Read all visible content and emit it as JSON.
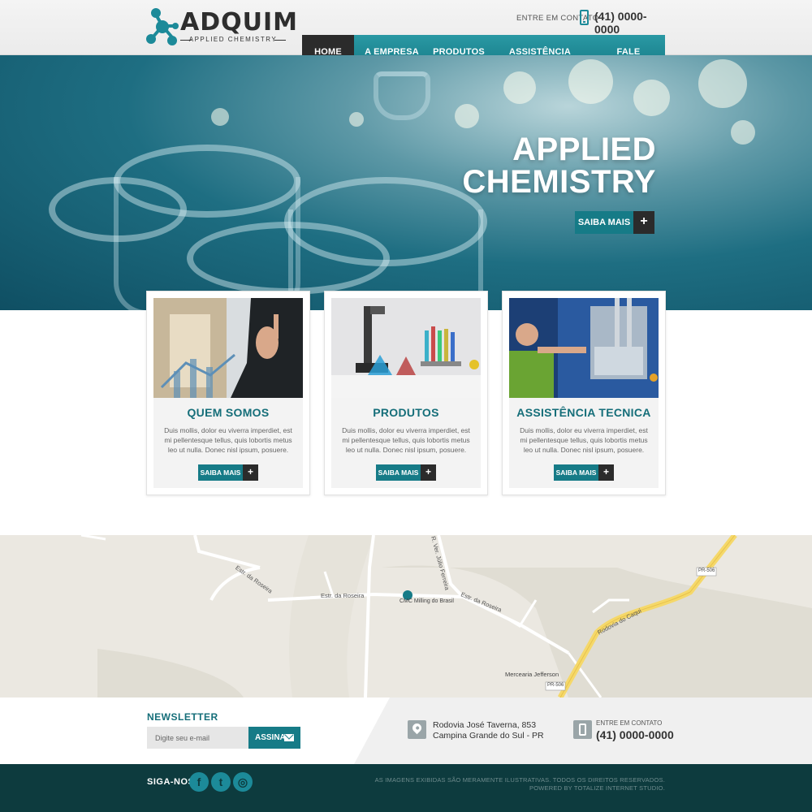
{
  "brand": {
    "name": "ADQUIM",
    "tagline": "APPLIED CHEMISTRY"
  },
  "header": {
    "contact_label": "ENTRE EM CONTATO",
    "phone": "(41) 0000-0000"
  },
  "nav": {
    "items": [
      "HOME",
      "A EMPRESA",
      "PRODUTOS",
      "ASSISTÊNCIA TÉCNICA",
      "FALE CONOSCO"
    ],
    "active": "HOME"
  },
  "hero": {
    "title_line1": "APPLIED",
    "title_line2": "CHEMISTRY",
    "button_label": "SAIBA MAIS",
    "button_icon": "+"
  },
  "cards": [
    {
      "title": "QUEM SOMOS",
      "text": "Duis mollis, dolor eu viverra imperdiet, est mi pellentesque tellus, quis lobortis metus leo ut nulla. Donec nisl ipsum, posuere.",
      "button_label": "SAIBA MAIS",
      "button_icon": "+"
    },
    {
      "title": "PRODUTOS",
      "text": "Duis mollis, dolor eu viverra imperdiet, est mi pellentesque tellus, quis lobortis metus leo ut nulla. Donec nisl ipsum, posuere.",
      "button_label": "SAIBA MAIS",
      "button_icon": "+"
    },
    {
      "title": "ASSISTÊNCIA TECNICA",
      "text": "Duis mollis, dolor eu viverra imperdiet, est mi pellentesque tellus, quis lobortis metus leo ut nulla. Donec nisl ipsum, posuere.",
      "button_label": "SAIBA MAIS",
      "button_icon": "+"
    }
  ],
  "map": {
    "labels": {
      "estr_roseira_1": "Estr. da Roseira",
      "estr_roseira_2": "Estr. da Roseira",
      "estr_roseira_3": "Estr. da Roseira",
      "ver_julio": "R. Ver. Júlio Ferreira",
      "marker": "CMC Milling do Brasil",
      "rodovia": "Rodovia do Caqui",
      "pr506_a": "PR-506",
      "pr506_b": "PR-506",
      "mercearia": "Mercearia Jefferson"
    }
  },
  "newsletter": {
    "title": "NEWSLETTER",
    "placeholder": "Digite seu e-mail",
    "button_label": "ASSINAR"
  },
  "address": {
    "line1": "Rodovia José Taverna, 853",
    "line2": "Campina Grande do Sul - PR"
  },
  "contact": {
    "label": "ENTRE EM CONTATO",
    "phone": "(41) 0000-0000"
  },
  "footer": {
    "follow_label": "SIGA-NOS",
    "social": [
      "f",
      "t",
      "◎"
    ],
    "copyright": "AS IMAGENS EXIBIDAS SÃO MERAMENTE ILUSTRATIVAS. TODOS OS DIREITOS RESERVADOS.",
    "powered": "POWERED BY TOTALIZE INTERNET STUDIO."
  },
  "colors": {
    "accent": "#167b87",
    "dark": "#2b2b2b",
    "footer": "#0d3b3e"
  }
}
